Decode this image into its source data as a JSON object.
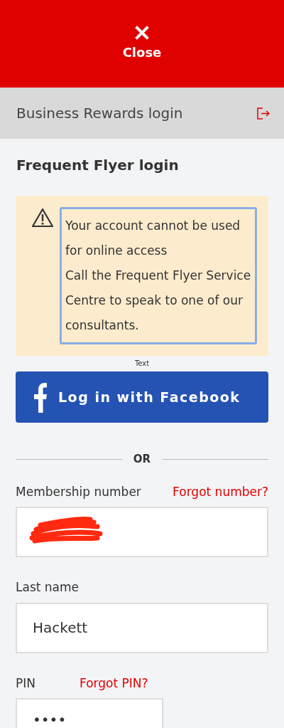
{
  "header": {
    "close_label": "Close"
  },
  "business_bar": {
    "title": "Business Rewards login"
  },
  "title": "Frequent Flyer login",
  "alert": {
    "lines": [
      "Your account cannot be used for online access",
      "Call the Frequent Flyer Service Centre to speak to one of our consultants."
    ],
    "caption": "Text"
  },
  "facebook_button": "Log in with Facebook",
  "divider": "OR",
  "fields": [
    {
      "label": "Membership number",
      "link": "Forgot number?",
      "redacted": true,
      "kind": "wide"
    },
    {
      "label": "Last name",
      "value": "Hackett",
      "kind": "wide"
    },
    {
      "label": "PIN",
      "link": "Forgot PIN?",
      "value": "••••",
      "kind": "narrow"
    }
  ]
}
